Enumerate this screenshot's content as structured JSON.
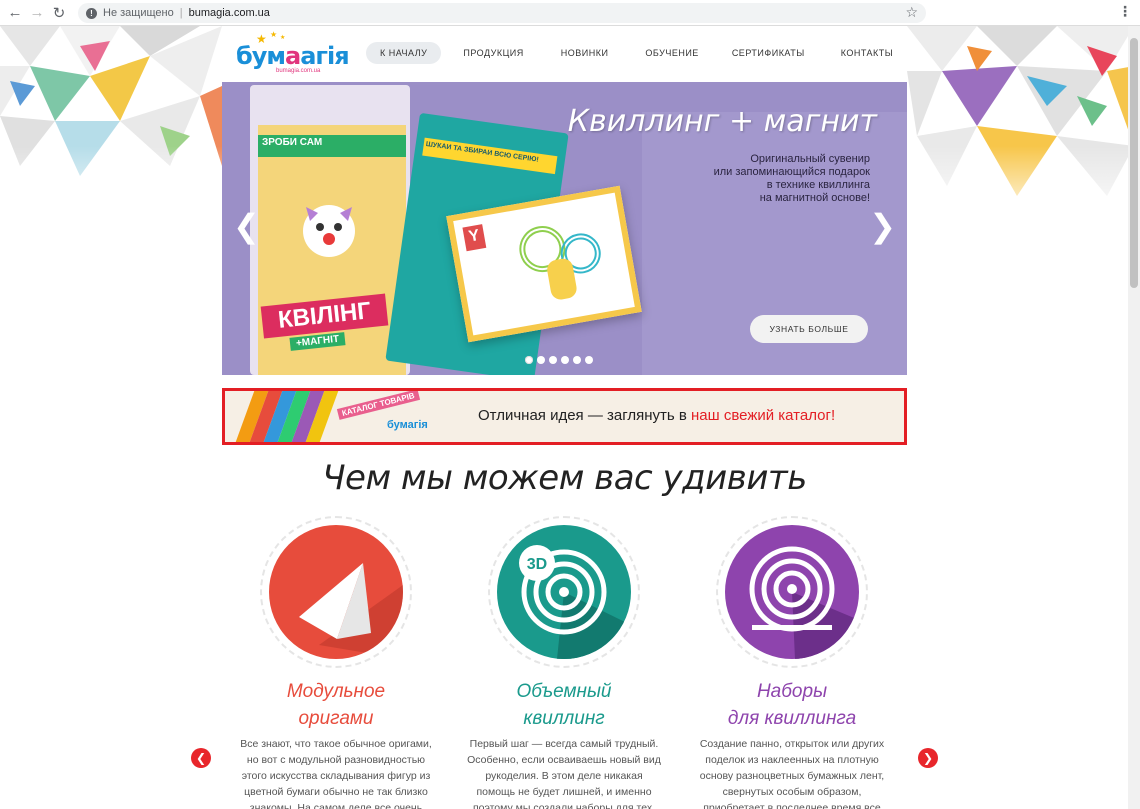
{
  "browser": {
    "security_label": "Не защищено",
    "url": "bumagia.com.ua",
    "back_icon": "back-arrow-icon",
    "forward_icon": "forward-arrow-icon",
    "reload_icon": "reload-icon"
  },
  "header": {
    "logo_text_1": "бум",
    "logo_text_2": "агія",
    "logo_sub": "bumagia.com.ua",
    "nav": [
      {
        "label": "К НАЧАЛУ",
        "active": true
      },
      {
        "label": "ПРОДУКЦИЯ"
      },
      {
        "label": "НОВИНКИ"
      },
      {
        "label": "ОБУЧЕНИЕ"
      },
      {
        "label": "СЕРТИФИКАТЫ"
      },
      {
        "label": "КОНТАКТЫ"
      }
    ]
  },
  "slider": {
    "title": "Квиллинг + магнит",
    "description": [
      "Оригинальный сувенир",
      "или запоминающийся подарок",
      "в технике квиллинга",
      "на магнитной основе!"
    ],
    "button": "УЗНАТЬ БОЛЬШЕ",
    "pack1_top": "ЗРОБИ САМ",
    "pack1_brand": "КВІЛІНГ",
    "pack1_sub": "+МАГНІТ",
    "pack2_strip": "ШУКАЙ ТА ЗБИРАЙ ВСЮ СЕРІЮ!",
    "dots_count": 6,
    "colors": {
      "bg": "#9b8fc7"
    }
  },
  "catalog": {
    "prefix": "Отличная идея — заглянуть в ",
    "highlight": "наш свежий каталог!",
    "deco_label": "КАТАЛОГ ТОВАРІВ"
  },
  "section": {
    "title": "Чем мы можем вас удивить",
    "features": [
      {
        "name_1": "Модульное",
        "name_2": "оригами",
        "color": "#e74c3c",
        "desc": "Все знают, что такое обычное оригами, но вот с модульной разновидностью этого искусства складывания фигур из цветной бумаги обычно не так близко знакомы. На самом деле все очень"
      },
      {
        "name_1": "Объемный",
        "name_2": "квиллинг",
        "color": "#1a9a8c",
        "badge": "3D",
        "desc": "Первый шаг — всегда самый трудный. Особенно, если осваиваешь новый вид рукоделия. В этом деле никакая помощь не будет лишней, и именно поэтому мы создали наборы для тех, кто только"
      },
      {
        "name_1": "Наборы",
        "name_2": "для квиллинга",
        "color": "#8e44ad",
        "desc": "Создание панно, открыток или других поделок из наклеенных на плотную основу разноцветных бумажных лент, свернутых особым образом, приобретает в последнее время все большую"
      }
    ]
  }
}
